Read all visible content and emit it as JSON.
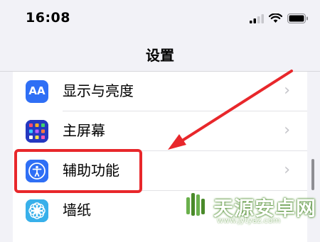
{
  "status_bar": {
    "time": "16:08"
  },
  "nav": {
    "title": "设置"
  },
  "rows": [
    {
      "label": "显示与亮度",
      "icon": "text-size-icon",
      "icon_text": "AA",
      "chevron": "›"
    },
    {
      "label": "主屏幕",
      "icon": "home-screen-icon",
      "chevron": "›"
    },
    {
      "label": "辅助功能",
      "icon": "accessibility-icon",
      "chevron": "›"
    },
    {
      "label": "墙纸",
      "icon": "wallpaper-flower-icon",
      "chevron": "›"
    }
  ],
  "watermark": {
    "text": "天源安卓网",
    "url": "www.jytyaz.com"
  },
  "colors": {
    "highlight": "#e8272b",
    "blue_icon": "#2f6ff5",
    "background": "#f2f2f7"
  }
}
